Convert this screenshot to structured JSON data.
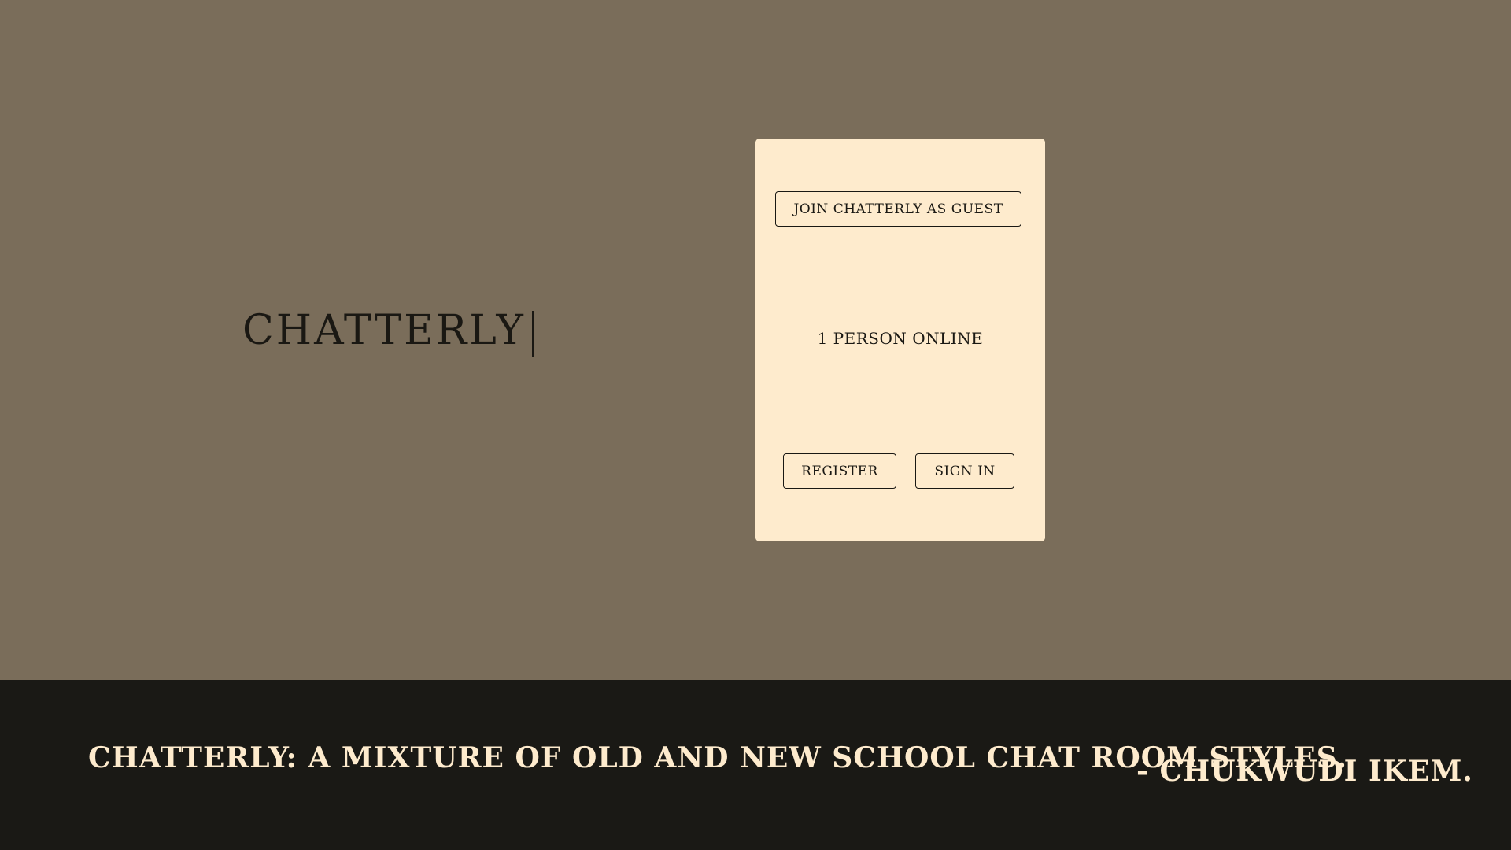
{
  "logo": {
    "text": "CHATTERLY"
  },
  "card": {
    "guest_button": "JOIN CHATTERLY AS GUEST",
    "online_status": "1 PERSON ONLINE",
    "register_button": "REGISTER",
    "signin_button": "SIGN IN"
  },
  "footer": {
    "quote": "CHATTERLY: A MIXTURE OF OLD AND NEW SCHOOL CHAT ROOM STYLES.",
    "author": "- CHUKWUDI IKEM."
  },
  "colors": {
    "background": "#7a6d5a",
    "card": "#feebcd",
    "footer": "#1a1915",
    "text_dark": "#1a1813",
    "text_light": "#feebcd"
  }
}
